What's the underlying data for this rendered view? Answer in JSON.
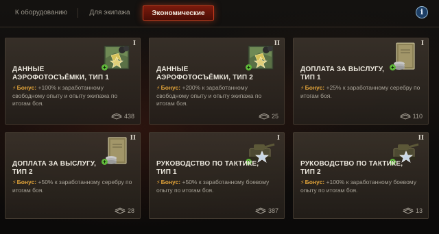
{
  "tabs": [
    {
      "label": "К оборудованию",
      "active": false
    },
    {
      "label": "Для экипажа",
      "active": false
    },
    {
      "label": "Экономические",
      "active": true
    }
  ],
  "info_button": {
    "label": "i"
  },
  "cards": [
    {
      "title_line1": "ДАННЫЕ",
      "title_line2": "АЭРОФОТОСЪЁМКИ, ТИП 1",
      "bonus_label": "Бонус:",
      "bonus_text": "+100% к заработанному свободному опыту и опыту экипажа по итогам боя.",
      "tier": "I",
      "count": "438",
      "icon": "aerial-photo-icon"
    },
    {
      "title_line1": "ДАННЫЕ",
      "title_line2": "АЭРОФОТОСЪЁМКИ, ТИП 2",
      "bonus_label": "Бонус:",
      "bonus_text": "+200% к заработанному свободному опыту и опыту экипажа по итогам боя.",
      "tier": "II",
      "count": "25",
      "icon": "aerial-photo-icon"
    },
    {
      "title_line1": "ДОПЛАТА ЗА ВЫСЛУГУ,",
      "title_line2": "ТИП 1",
      "bonus_label": "Бонус:",
      "bonus_text": "+25% к заработанному серебру по итогам боя.",
      "tier": "I",
      "count": "110",
      "icon": "service-bonus-icon"
    },
    {
      "title_line1": "ДОПЛАТА ЗА ВЫСЛУГУ,",
      "title_line2": "ТИП 2",
      "bonus_label": "Бонус:",
      "bonus_text": "+50% к заработанному серебру по итогам боя.",
      "tier": "II",
      "count": "28",
      "icon": "service-bonus-icon"
    },
    {
      "title_line1": "РУКОВОДСТВО ПО ТАКТИКЕ,",
      "title_line2": "ТИП 1",
      "bonus_label": "Бонус:",
      "bonus_text": "+50% к заработанному боевому опыту по итогам боя.",
      "tier": "I",
      "count": "387",
      "icon": "tactics-guide-icon"
    },
    {
      "title_line1": "РУКОВОДСТВО ПО ТАКТИКЕ,",
      "title_line2": "ТИП 2",
      "bonus_label": "Бонус:",
      "bonus_text": "+100% к заработанному боевому опыту по итогам боя.",
      "tier": "II",
      "count": "13",
      "icon": "tactics-guide-icon"
    }
  ],
  "colors": {
    "accent_red": "#c83c1e",
    "bonus_orange": "#e3a53a",
    "plus_green": "#5fb83a",
    "info_blue": "#1d3f66"
  }
}
